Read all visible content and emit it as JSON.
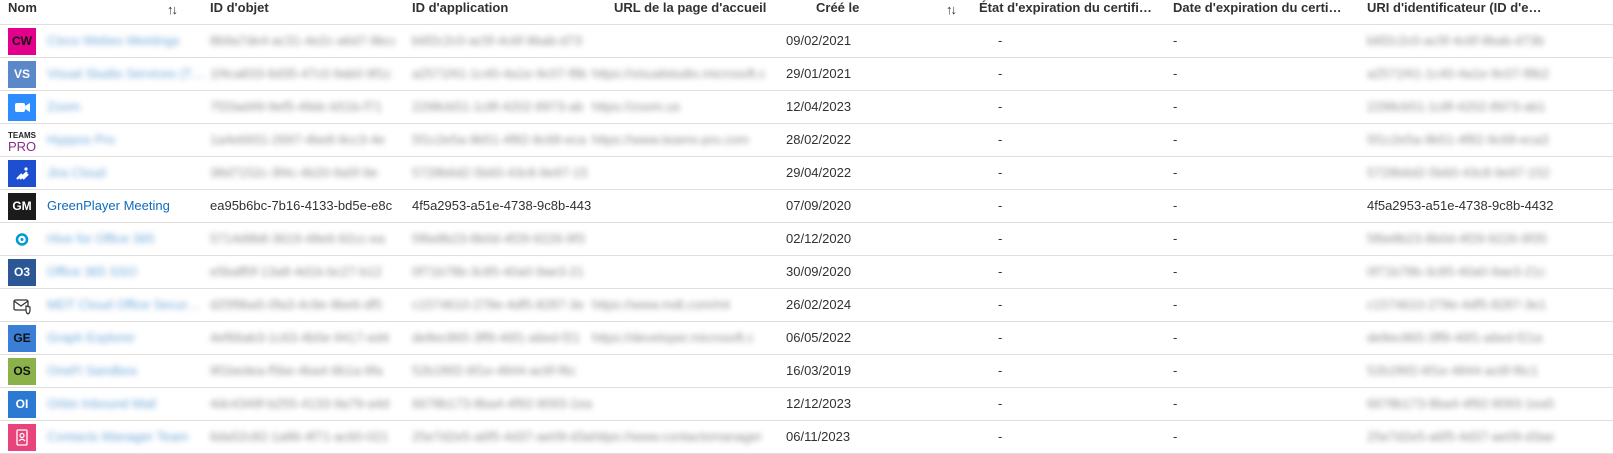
{
  "colors": {
    "link": "#0f6cbd",
    "text": "#323130",
    "divider": "#e1dfdd"
  },
  "header": {
    "name": "Nom",
    "object_id": "ID d'objet",
    "app_id": "ID d'application",
    "homepage_url": "URL de la page d'accueil",
    "created": "Créé le",
    "cert_status": "État d'expiration du certifi…",
    "cert_date": "Date d'expiration du certif…",
    "identifier_uri": "URI d'identificateur (ID d'e…",
    "sort_icon_name": "↑↓",
    "sort_icon_created": "↑↓"
  },
  "rows": [
    {
      "icon_text": "CW",
      "icon_color": "#e3008c",
      "icon_name": "app-avatar",
      "name": "Cisco Webex Meetings",
      "object_id": "8b9a7de4-ac31-4e2c-a6d7-9bca",
      "app_id": "b6f2c2c0-ac5f-4c6f-9bab-d73",
      "url": "",
      "created": "09/02/2021",
      "cert_status": "-",
      "cert_date": "-",
      "uri": "b6f2c2c0-ac5f-4c6f-9bab-d73b",
      "blurred": true
    },
    {
      "icon_text": "VS",
      "icon_color": "#5b88c9",
      "icon_name": "app-avatar",
      "name": "Visual Studio Services (T…",
      "object_id": "1f4ca833-6d35-47c0-9ab0-9f1c",
      "app_id": "a2571f41-1c40-4a1e-9c07-f8b",
      "url": "https://visualstudio.microsoft.c",
      "created": "29/01/2021",
      "cert_status": "-",
      "cert_date": "-",
      "uri": "a2571f41-1c40-4a1e-9c07-f8b2",
      "blurred": true
    },
    {
      "icon_text": "",
      "icon_color": "#2d8cff",
      "icon_name": "zoom-camera-icon",
      "name": "Zoom",
      "object_id": "7f20ad49-9ef5-49dc-b51b-f71",
      "app_id": "2298cb51-1c8f-4202-8973-ab",
      "url": "https://zoom.us",
      "created": "12/04/2023",
      "cert_status": "-",
      "cert_date": "-",
      "uri": "2298cb51-1c8f-4202-8973-ab1",
      "blurred": true
    },
    {
      "icon_text": "TEAMS PRO",
      "icon_color": "#ffffff",
      "icon_name": "teams-pro-logo",
      "name": "Hyppos Pro",
      "object_id": "1a4e6931-2697-4be8-9cc3-4e",
      "app_id": "5f1c2e5a-9b51-4f82-9c68-eca",
      "url": "https://www.teams-pro.com",
      "created": "28/02/2022",
      "cert_status": "-",
      "cert_date": "-",
      "uri": "5f1c2e5a-9b51-4f82-9c68-eca3",
      "blurred": true
    },
    {
      "icon_text": "",
      "icon_color": "#1f4fd1",
      "icon_name": "jira-cloud-icon",
      "name": "Jira Cloud",
      "object_id": "38d7152c-3f4c-4b20-9a5f-9e",
      "app_id": "5728b6d2-5b60-43c8-9e97-15",
      "url": "",
      "created": "29/04/2022",
      "cert_status": "-",
      "cert_date": "-",
      "uri": "5728b6d2-5b60-43c8-9e97-152",
      "blurred": true
    },
    {
      "icon_text": "GM",
      "icon_color": "#1b1b1b",
      "icon_name": "app-avatar",
      "name": "GreenPlayer Meeting",
      "object_id": "ea95b6bc-7b16-4133-bd5e-e8c",
      "app_id": "4f5a2953-a51e-4738-9c8b-443",
      "url": "",
      "created": "07/09/2020",
      "cert_status": "-",
      "cert_date": "-",
      "uri": "4f5a2953-a51e-4738-9c8b-4432",
      "blurred": false
    },
    {
      "icon_text": "",
      "icon_color": "#0099d6",
      "icon_name": "ring-icon",
      "name": "Hive for Office 365",
      "object_id": "5714d9b8-3619-48e6-92cc-ea",
      "app_id": "5f6e8b23-8b0d-4f29-9226-9f3",
      "url": "",
      "created": "02/12/2020",
      "cert_status": "-",
      "cert_date": "-",
      "uri": "5f6e8b23-8b0d-4f29-9226-9f35",
      "blurred": true
    },
    {
      "icon_text": "O3",
      "icon_color": "#2b5797",
      "icon_name": "app-avatar",
      "name": "Office 365 SSO",
      "object_id": "e5baff0f-13a8-4d1b-bc27-b12",
      "app_id": "0f71b78b-3c85-40a0-9ae3-21",
      "url": "",
      "created": "30/09/2020",
      "cert_status": "-",
      "cert_date": "-",
      "uri": "0f71b78b-3c85-40a0-9ae3-21c",
      "blurred": true
    },
    {
      "icon_text": "",
      "icon_color": "#ffffff",
      "icon_name": "mail-shield-icon",
      "name": "MDT Cloud Office Secur…",
      "object_id": "d25f9ba5-0fa3-4c9e-9be6-df5",
      "app_id": "c1574610-278e-4df5-8287-3e",
      "url": "https://www.mdt.com/mt",
      "created": "26/02/2024",
      "cert_status": "-",
      "cert_date": "-",
      "uri": "c1574610-278e-4df5-8287-3e1",
      "blurred": true
    },
    {
      "icon_text": "GE",
      "icon_color": "#3a7fd5",
      "icon_name": "app-avatar",
      "name": "Graph Explorer",
      "object_id": "4ef66ab3-1c63-4b0e-9417-ed4",
      "app_id": "de8ec865-3ff9-46f1-a6ed-f21",
      "url": "https://developer.microsoft.c",
      "created": "06/05/2022",
      "cert_status": "-",
      "cert_date": "-",
      "uri": "de8ec865-3ff9-46f1-a6ed-f21a",
      "blurred": true
    },
    {
      "icon_text": "OS",
      "icon_color": "#8bb24a",
      "icon_name": "app-avatar",
      "name": "OneFi Sandbox",
      "object_id": "9f1bedea-f5be-4ba4-9b1a-9fa",
      "app_id": "52b1f6f2-6f1e-4844-ac6f-f6c",
      "url": "",
      "created": "16/03/2019",
      "cert_status": "-",
      "cert_date": "-",
      "uri": "52b1f6f2-6f1e-4844-ac6f-f6c1",
      "blurred": true
    },
    {
      "icon_text": "OI",
      "icon_color": "#2b79d3",
      "icon_name": "app-avatar",
      "name": "Orbis Inbound Mail",
      "object_id": "4dc4349f-b255-4133-9a79-a4d",
      "app_id": "6678b173-8ba4-4f92-9093-1ea",
      "url": "",
      "created": "12/12/2023",
      "cert_status": "-",
      "cert_date": "-",
      "uri": "6678b173-8ba4-4f92-9093-1ea5",
      "blurred": true
    },
    {
      "icon_text": "",
      "icon_color": "#e8437a",
      "icon_name": "contact-card-icon",
      "name": "Contacts Manager Team",
      "object_id": "6da52c82-1a86-4f71-ac60-021",
      "app_id": "25e7d2e5-a6f5-4d37-ae09-d3a",
      "url": "https://www.contactsmanager",
      "created": "06/11/2023",
      "cert_status": "-",
      "cert_date": "-",
      "uri": "25e7d2e5-a6f5-4d37-ae09-d3ae",
      "blurred": true
    }
  ]
}
